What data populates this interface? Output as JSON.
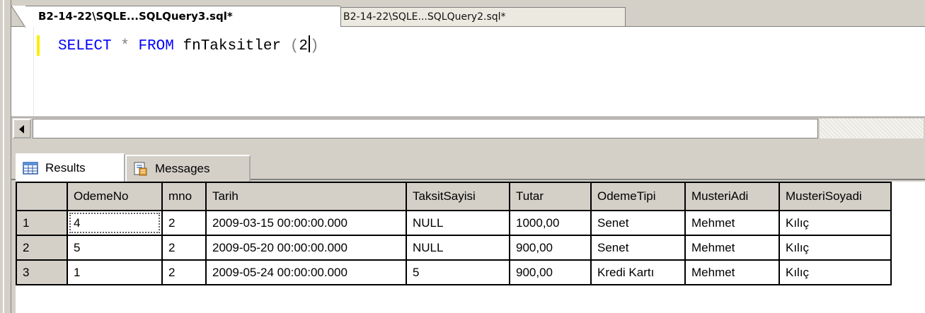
{
  "editor_tabs": [
    {
      "label": "B2-14-22\\SQLE...SQLQuery3.sql*",
      "active": true
    },
    {
      "label": "B2-14-22\\SQLE...SQLQuery2.sql*",
      "active": false
    }
  ],
  "query": {
    "select": "SELECT",
    "star": "*",
    "from": "FROM",
    "function_name": "fnTaksitler",
    "paren_open": "(",
    "argument": "2",
    "paren_close": ")"
  },
  "result_tabs": {
    "results_label": "Results",
    "messages_label": "Messages"
  },
  "grid": {
    "columns": [
      "OdemeNo",
      "mno",
      "Tarih",
      "TaksitSayisi",
      "Tutar",
      "OdemeTipi",
      "MusteriAdi",
      "MusteriSoyadi"
    ],
    "rows": [
      {
        "num": "1",
        "cells": [
          "4",
          "2",
          "2009-03-15 00:00:00.000",
          "NULL",
          "1000,00",
          "Senet",
          "Mehmet",
          "Kılıç"
        ]
      },
      {
        "num": "2",
        "cells": [
          "5",
          "2",
          "2009-05-20 00:00:00.000",
          "NULL",
          "900,00",
          "Senet",
          "Mehmet",
          "Kılıç"
        ]
      },
      {
        "num": "3",
        "cells": [
          "1",
          "2",
          "2009-05-24 00:00:00.000",
          "5",
          "900,00",
          "Kredi Kartı",
          "Mehmet",
          "Kılıç"
        ]
      }
    ]
  },
  "colors": {
    "keyword": "#0000ff",
    "operator": "#808080",
    "change_indicator": "#ffee00",
    "chrome": "#d4d0c8"
  },
  "icons": {
    "results": "grid-icon",
    "messages": "messages-icon",
    "scroll_left": "arrow-left-icon"
  }
}
